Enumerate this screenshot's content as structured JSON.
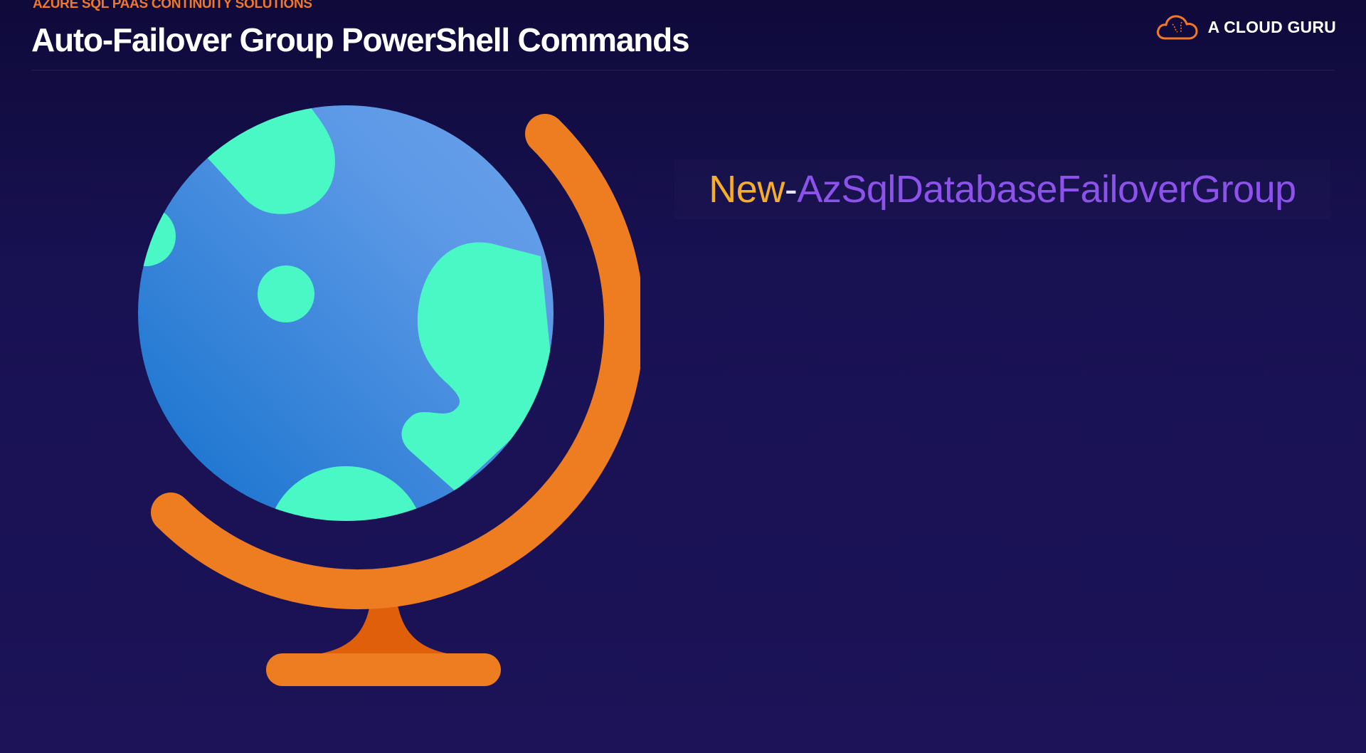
{
  "header": {
    "eyebrow": "AZURE SQL PAAS CONTINUITY SOLUTIONS",
    "title": "Auto-Failover Group PowerShell Commands"
  },
  "brand": {
    "name": "A CLOUD GURU",
    "icon": "cloud-icon",
    "color": "#f0782a"
  },
  "illustration": {
    "icon": "globe-icon",
    "colors": {
      "ocean_light": "#5b98e6",
      "ocean_dark": "#1370cc",
      "land": "#4af8c6",
      "stand": "#ee7d22",
      "stand_shadow": "#e05f0b"
    }
  },
  "command": {
    "verb": "New",
    "separator": "-",
    "noun": "AzSqlDatabaseFailoverGroup",
    "colors": {
      "verb": "#f5ad2a",
      "noun": "#8d52ec"
    }
  }
}
